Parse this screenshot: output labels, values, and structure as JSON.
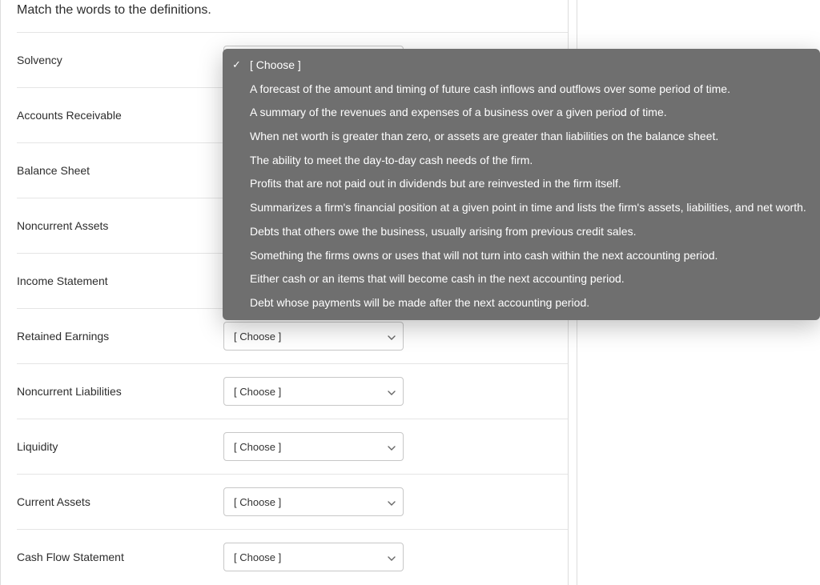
{
  "instruction": "Match the words to the definitions.",
  "choose_label": "[ Choose ]",
  "terms": [
    "Solvency",
    "Accounts Receivable",
    "Balance Sheet",
    "Noncurrent Assets",
    "Income Statement",
    "Retained Earnings",
    "Noncurrent Liabilities",
    "Liquidity",
    "Current Assets",
    "Cash Flow Statement"
  ],
  "dropdown_options": [
    "[ Choose ]",
    "A forecast of the amount and timing of future cash inflows and outflows over some period of time.",
    "A summary of the revenues and expenses of a business over a given period of time.",
    "When net worth is greater than zero, or assets are greater than liabilities on the balance sheet.",
    "The ability to meet the day-to-day cash needs of the firm.",
    "Profits that are not paid out in dividends but are reinvested in the firm itself.",
    "Summarizes a firm's financial position at a given point in time and lists the firm's assets, liabilities, and net worth.",
    "Debts that others owe the business, usually arising from previous credit sales.",
    "Something the firms owns or uses that will not turn into cash within the next accounting period.",
    "Either cash or an items that will become cash in the next accounting period.",
    "Debt whose payments will be made after the next accounting period."
  ],
  "dropdown_selected_index": 0
}
